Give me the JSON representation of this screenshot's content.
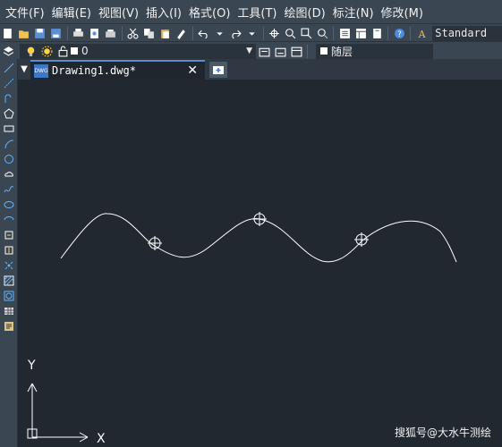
{
  "menu": [
    "文件(F)",
    "编辑(E)",
    "视图(V)",
    "插入(I)",
    "格式(O)",
    "工具(T)",
    "绘图(D)",
    "标注(N)",
    "修改(M)"
  ],
  "toolbar": {
    "text_style": "Standard",
    "layer_name": "0",
    "linetype": "随层",
    "icons": [
      "new-icon",
      "open-icon",
      "save-icon",
      "saveas-icon",
      "print-icon",
      "preview-icon",
      "plot-icon",
      "cut-icon",
      "copy-icon",
      "paste-icon",
      "matchprop-icon",
      "undo-icon",
      "redo-icon",
      "pan-icon",
      "zoom-realtime-icon",
      "zoom-window-icon",
      "zoom-previous-icon",
      "properties-icon",
      "design-center-icon",
      "tool-palette-icon",
      "help-icon",
      "text-style-icon"
    ]
  },
  "layer_toolbar_icons": [
    "layer-manager-icon",
    "lightbulb-icon",
    "sun-icon",
    "lock-icon"
  ],
  "left_tools": [
    "line-icon",
    "construction-line-icon",
    "polyline-icon",
    "polygon-icon",
    "rectangle-icon",
    "arc-icon",
    "circle-icon",
    "revcloud-icon",
    "spline-icon",
    "ellipse-icon",
    "ellipse-arc-icon",
    "insert-block-icon",
    "make-block-icon",
    "point-icon",
    "hatch-icon",
    "region-icon",
    "table-icon",
    "mtext-icon"
  ],
  "tab": {
    "label": "Drawing1.dwg*",
    "close": "✕",
    "logo_text": "DWG"
  },
  "ucs": {
    "x_label": "X",
    "y_label": "Y"
  },
  "watermark": "搜狐号@大水牛测绘",
  "colors": {
    "background": "#212830",
    "toolbar": "#3b4653",
    "curve": "#ffffff",
    "tab_accent": "#5d8dc3"
  }
}
